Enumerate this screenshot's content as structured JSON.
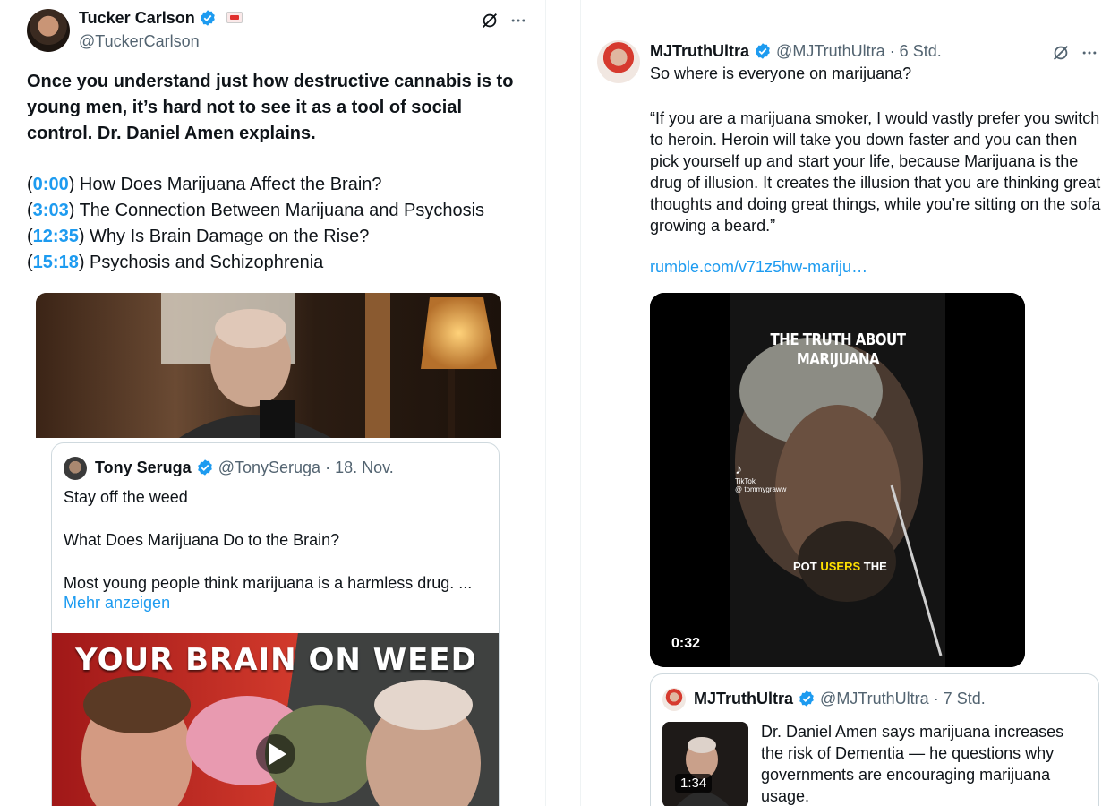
{
  "left_post": {
    "author": {
      "name": "Tucker Carlson",
      "handle": "@TuckerCarlson"
    },
    "text": "Once you understand just how destructive cannabis is to young men, it’s hard not to see it as a tool of social control. Dr. Daniel Amen explains.",
    "chapters": [
      {
        "time": "0:00",
        "title": "How Does Marijuana Affect the Brain?"
      },
      {
        "time": "3:03",
        "title": "The Connection Between Marijuana and Psychosis"
      },
      {
        "time": "12:35",
        "title": "Why Is Brain Damage on the Rise?"
      },
      {
        "time": "15:18",
        "title": "Psychosis and Schizophrenia"
      }
    ],
    "quoted": {
      "author": {
        "name": "Tony Seruga",
        "handle": "@TonySeruga",
        "date": "· 18. Nov."
      },
      "lines": [
        "Stay off the weed",
        "What Does Marijuana Do to the Brain?",
        "Most young people think marijuana is a harmless drug. ..."
      ],
      "more_label": "Mehr anzeigen",
      "thumb_title": "YOUR BRAIN ON WEED"
    }
  },
  "right_post": {
    "author": {
      "name": "MJTruthUltra",
      "handle": "@MJTruthUltra",
      "time": "· 6 Std."
    },
    "line1": "So where is everyone on marijuana?",
    "quote": "“If you are a marijuana smoker, I would vastly prefer you switch to heroin. Heroin will take you down faster and you can then pick yourself up and start your life, because Marijuana is the drug of illusion. It creates the illusion that you are thinking great thoughts and doing great things, while you’re sitting on the sofa growing a beard.”",
    "link": "rumble.com/v71z5hw-mariju…",
    "video": {
      "title": "THE TRUTH ABOUT MARIJUANA",
      "caption_a": "POT ",
      "caption_b": "USERS",
      "caption_c": " THE",
      "tiktok_label": "TikTok",
      "tiktok_user": "@ tommygraww",
      "duration": "0:32"
    },
    "quoted": {
      "author": {
        "name": "MJTruthUltra",
        "handle": "@MJTruthUltra",
        "time": "· 7 Std."
      },
      "text": "Dr. Daniel Amen says marijuana increases the risk of Dementia — he questions why governments are encouraging marijuana usage.",
      "duration": "1:34"
    }
  }
}
